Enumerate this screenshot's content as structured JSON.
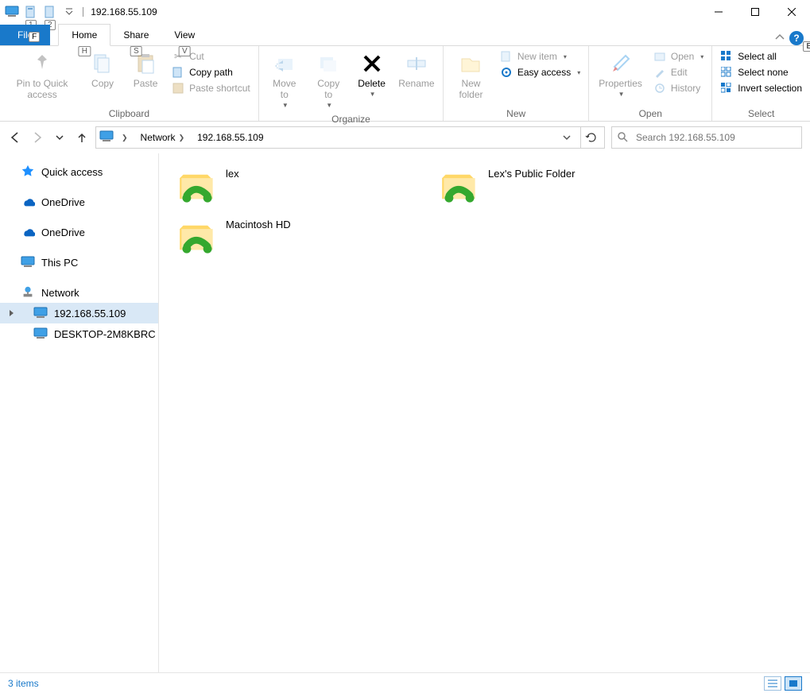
{
  "window_title": "192.168.55.109",
  "qat_hints": [
    "1",
    "2"
  ],
  "tabs": {
    "file": "File",
    "file_hint": "F",
    "home": "Home",
    "home_hint": "H",
    "share": "Share",
    "share_hint": "S",
    "view": "View",
    "view_hint": "V"
  },
  "ribbon": {
    "pin": "Pin to Quick access",
    "copy": "Copy",
    "paste": "Paste",
    "cut": "Cut",
    "copy_path": "Copy path",
    "paste_shortcut": "Paste shortcut",
    "clipboard": "Clipboard",
    "move_to": "Move to",
    "copy_to": "Copy to",
    "delete": "Delete",
    "rename": "Rename",
    "organize": "Organize",
    "new_folder": "New folder",
    "new_item": "New item",
    "easy_access": "Easy access",
    "new": "New",
    "properties": "Properties",
    "open": "Open",
    "edit": "Edit",
    "history": "History",
    "open_group": "Open",
    "select_all": "Select all",
    "select_none": "Select none",
    "invert_selection": "Invert selection",
    "select": "Select"
  },
  "breadcrumb": {
    "network": "Network",
    "host": "192.168.55.109"
  },
  "search_placeholder": "Search 192.168.55.109",
  "sidebar": {
    "quick_access": "Quick access",
    "onedrive1": "OneDrive",
    "onedrive2": "OneDrive",
    "this_pc": "This PC",
    "network": "Network",
    "host": "192.168.55.109",
    "desktop": "DESKTOP-2M8KBRC"
  },
  "folders": [
    {
      "name": "lex"
    },
    {
      "name": "Lex's Public Folder"
    },
    {
      "name": "Macintosh HD"
    }
  ],
  "status_text": "3 items"
}
